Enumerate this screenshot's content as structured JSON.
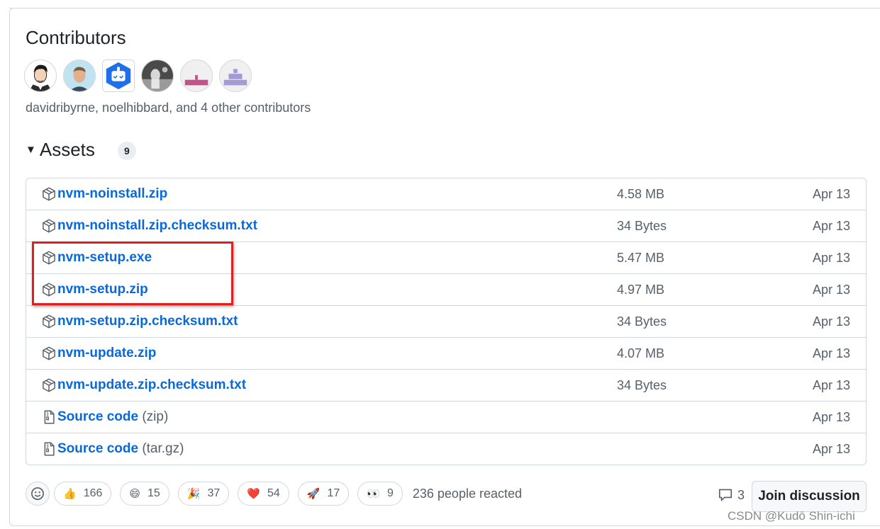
{
  "contributors": {
    "heading": "Contributors",
    "avatars": [
      {
        "name": "avatar-cartoon-man",
        "bg": "#ffffff"
      },
      {
        "name": "avatar-man-photo",
        "bg": "#bfe3f0"
      },
      {
        "name": "avatar-bot",
        "bg": "#1f6feb"
      },
      {
        "name": "avatar-bw-photo",
        "bg": "#555555"
      },
      {
        "name": "avatar-identicon-pink",
        "bg": "#f0f0f0",
        "fg": "#c2548a"
      },
      {
        "name": "avatar-identicon-lavender",
        "bg": "#f0f0f0",
        "fg": "#a29bd6"
      }
    ],
    "summary": "davidribyrne, noelhibbard, and 4 other contributors"
  },
  "assets": {
    "title": "Assets",
    "count": "9",
    "rows": [
      {
        "name": "nvm-noinstall.zip",
        "sub": "",
        "size": "4.58 MB",
        "date": "Apr 13",
        "icon": "package-icon"
      },
      {
        "name": "nvm-noinstall.zip.checksum.txt",
        "sub": "",
        "size": "34 Bytes",
        "date": "Apr 13",
        "icon": "package-icon"
      },
      {
        "name": "nvm-setup.exe",
        "sub": "",
        "size": "5.47 MB",
        "date": "Apr 13",
        "icon": "package-icon"
      },
      {
        "name": "nvm-setup.zip",
        "sub": "",
        "size": "4.97 MB",
        "date": "Apr 13",
        "icon": "package-icon"
      },
      {
        "name": "nvm-setup.zip.checksum.txt",
        "sub": "",
        "size": "34 Bytes",
        "date": "Apr 13",
        "icon": "package-icon"
      },
      {
        "name": "nvm-update.zip",
        "sub": "",
        "size": "4.07 MB",
        "date": "Apr 13",
        "icon": "package-icon"
      },
      {
        "name": "nvm-update.zip.checksum.txt",
        "sub": "",
        "size": "34 Bytes",
        "date": "Apr 13",
        "icon": "package-icon"
      },
      {
        "name": "Source code",
        "sub": "(zip)",
        "size": "",
        "date": "Apr 13",
        "icon": "file-zip-icon"
      },
      {
        "name": "Source code",
        "sub": "(tar.gz)",
        "size": "",
        "date": "Apr 13",
        "icon": "file-zip-icon"
      }
    ]
  },
  "reactions": {
    "items": [
      {
        "emoji": "👍",
        "icon": "thumbs-up-icon",
        "count": "166"
      },
      {
        "emoji": "😄",
        "icon": "laugh-icon",
        "count": "15"
      },
      {
        "emoji": "🎉",
        "icon": "hooray-icon",
        "count": "37"
      },
      {
        "emoji": "❤️",
        "icon": "heart-icon",
        "count": "54"
      },
      {
        "emoji": "🚀",
        "icon": "rocket-icon",
        "count": "17"
      },
      {
        "emoji": "👀",
        "icon": "eyes-icon",
        "count": "9"
      }
    ],
    "total": "236 people reacted"
  },
  "discussion": {
    "comment_count": "3",
    "join_label": "Join discussion"
  },
  "watermark": "CSDN @Kudō Shin-ichi",
  "colors": {
    "link": "#0969da",
    "muted": "#57606a",
    "border": "#d0d7de",
    "highlight": "#e02020"
  }
}
